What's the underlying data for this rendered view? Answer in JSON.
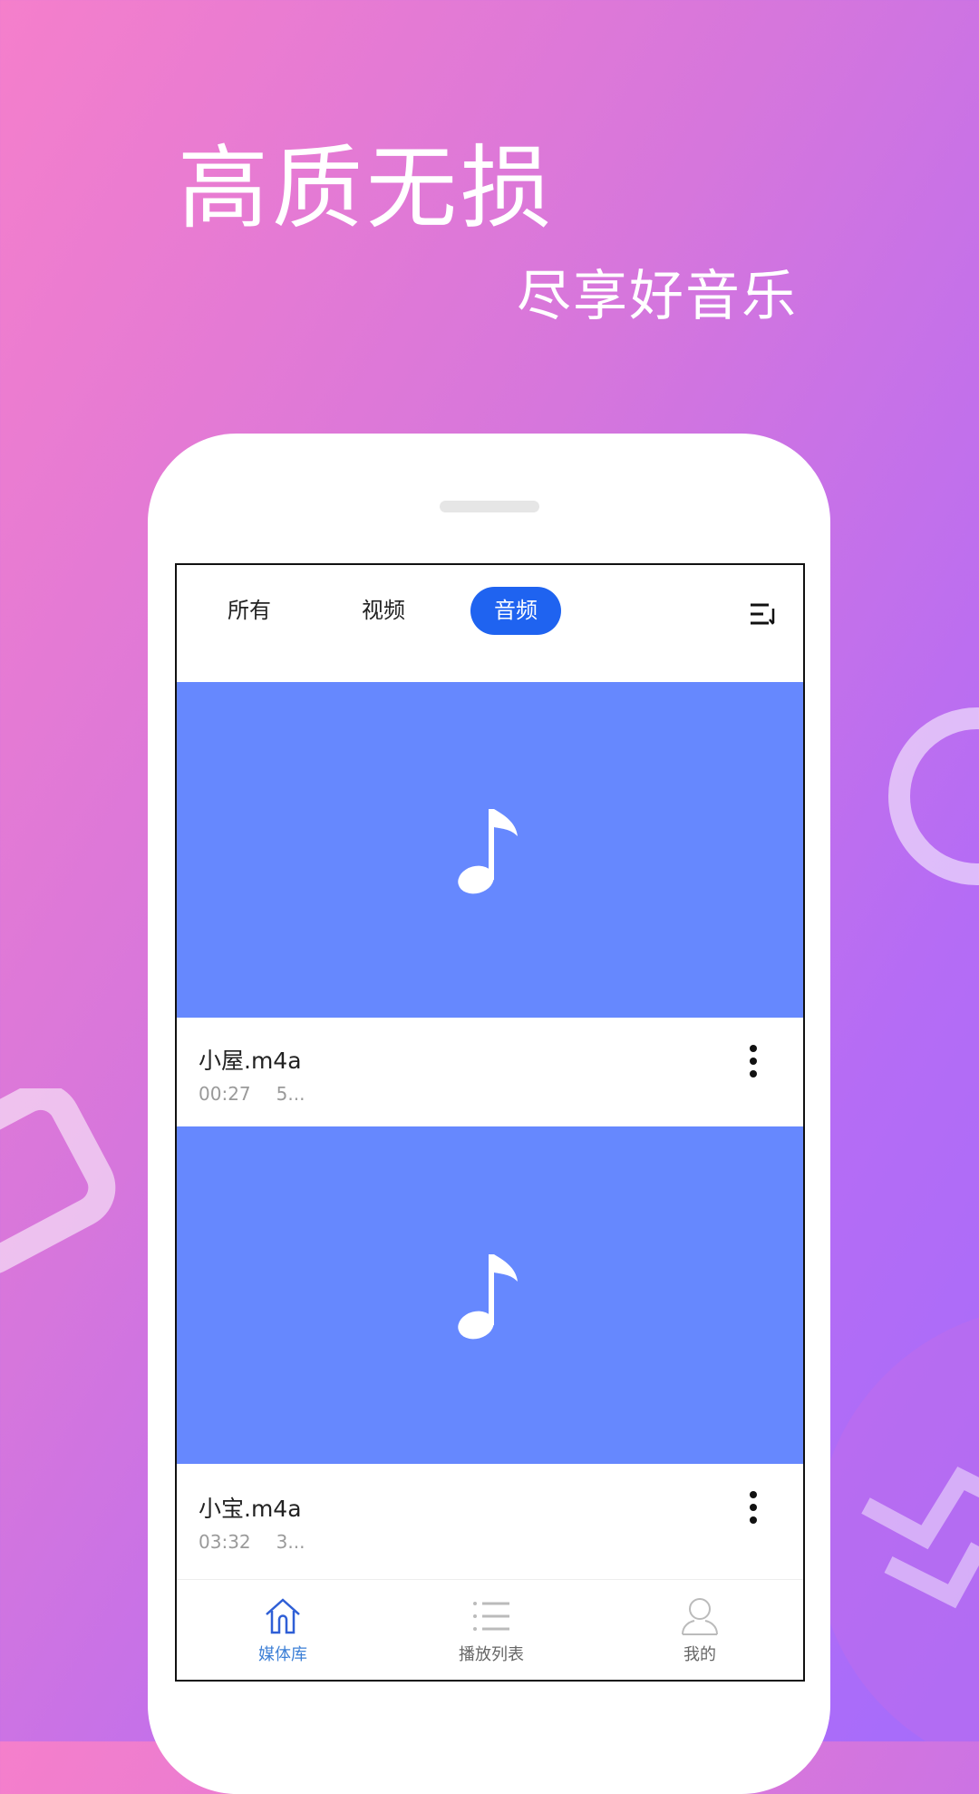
{
  "promo": {
    "headline": "高质无损",
    "subline": "尽享好音乐"
  },
  "colors": {
    "accent": "#1f63f0",
    "thumbnail": "#6688fe",
    "nav_active": "#3c7fd6"
  },
  "tabs": [
    {
      "label": "所有",
      "active": false
    },
    {
      "label": "视频",
      "active": false
    },
    {
      "label": "音频",
      "active": true
    }
  ],
  "sort_icon": "sort-icon",
  "media": [
    {
      "title": "小屋.m4a",
      "duration": "00:27",
      "size": "5...",
      "icon": "music-note-icon"
    },
    {
      "title": "小宝.m4a",
      "duration": "03:32",
      "size": "3...",
      "icon": "music-note-icon"
    }
  ],
  "nav": [
    {
      "label": "媒体库",
      "icon": "home-icon",
      "active": true
    },
    {
      "label": "播放列表",
      "icon": "list-icon",
      "active": false
    },
    {
      "label": "我的",
      "icon": "user-icon",
      "active": false
    }
  ]
}
